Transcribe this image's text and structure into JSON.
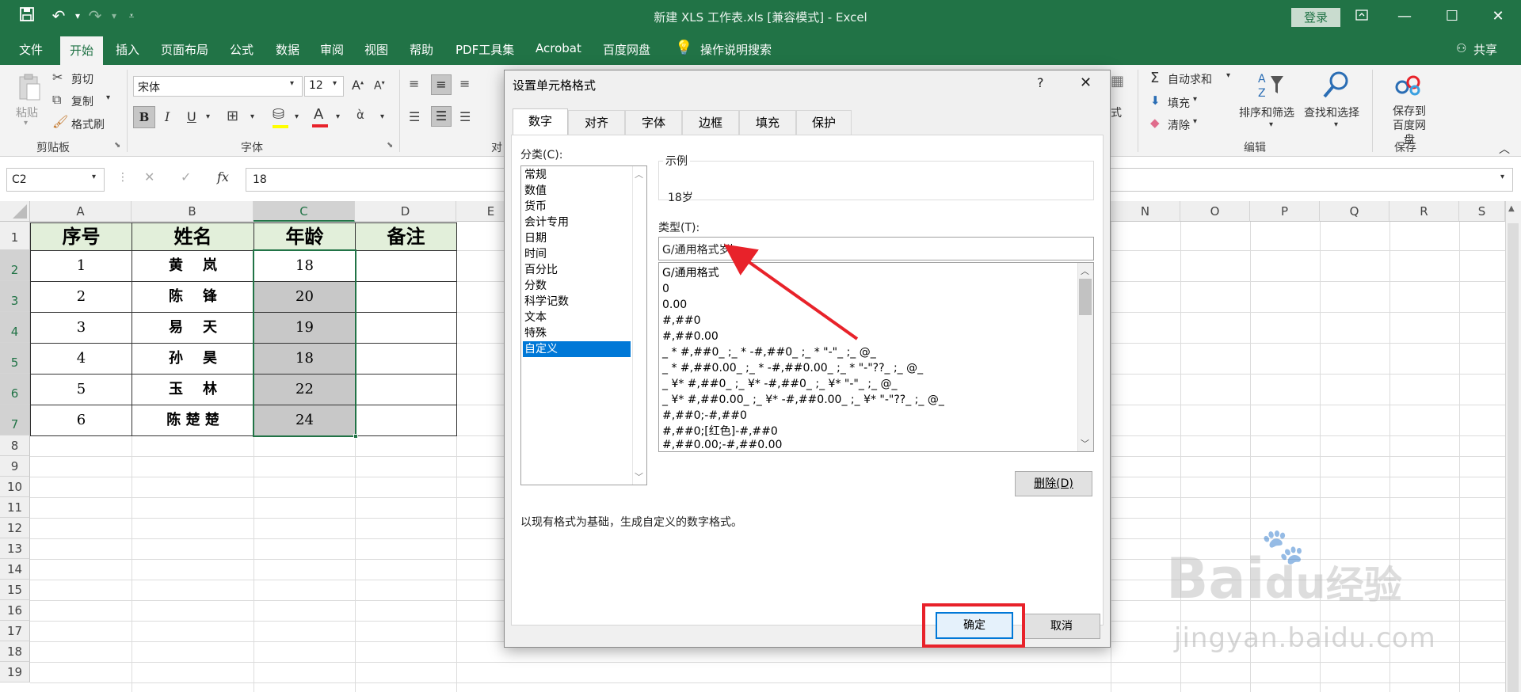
{
  "window": {
    "title": "新建 XLS 工作表.xls  [兼容模式]  -  Excel",
    "login_label": "登录",
    "share_label": "共享"
  },
  "menu": {
    "items": [
      "文件",
      "开始",
      "插入",
      "页面布局",
      "公式",
      "数据",
      "审阅",
      "视图",
      "帮助",
      "PDF工具集",
      "Acrobat",
      "百度网盘"
    ],
    "active": "开始",
    "tell_me": "操作说明搜索"
  },
  "ribbon": {
    "clipboard": {
      "paste": "粘贴",
      "cut": "剪切",
      "copy": "复制",
      "format_painter": "格式刷",
      "label": "剪贴板"
    },
    "font": {
      "name": "宋体",
      "size": "12",
      "label": "字体",
      "bold": "B",
      "italic": "I",
      "underline": "U"
    },
    "align_label_partial": "对",
    "editing": {
      "autosum": "自动求和",
      "fill": "填充",
      "clear": "清除",
      "sort_filter": "排序和筛选",
      "find_select": "查找和选择",
      "label": "编辑"
    },
    "save": {
      "save_baidu": "保存到百度网盘",
      "label": "保存"
    },
    "partial_cells": "式"
  },
  "formula_bar": {
    "name_box": "C2",
    "fx": "fx",
    "value": "18"
  },
  "sheet": {
    "columns": [
      "A",
      "B",
      "C",
      "D",
      "E",
      "N",
      "O",
      "P",
      "Q",
      "R",
      "S"
    ],
    "rows": [
      "1",
      "2",
      "3",
      "4",
      "5",
      "6",
      "7",
      "8",
      "9",
      "10",
      "11",
      "12",
      "13",
      "14",
      "15",
      "16",
      "17",
      "18",
      "19"
    ],
    "headers": [
      "序号",
      "姓名",
      "年龄",
      "备注"
    ],
    "data": [
      {
        "no": "1",
        "name": "黄    岚",
        "age": "18"
      },
      {
        "no": "2",
        "name": "陈    锋",
        "age": "20"
      },
      {
        "no": "3",
        "name": "易    天",
        "age": "19"
      },
      {
        "no": "4",
        "name": "孙    昊",
        "age": "18"
      },
      {
        "no": "5",
        "name": "玉    林",
        "age": "22"
      },
      {
        "no": "6",
        "name": "陈 楚 楚",
        "age": "24"
      }
    ]
  },
  "dialog": {
    "title": "设置单元格格式",
    "help": "?",
    "close": "✕",
    "tabs": [
      "数字",
      "对齐",
      "字体",
      "边框",
      "填充",
      "保护"
    ],
    "active_tab": "数字",
    "category_label": "分类(C):",
    "categories": [
      "常规",
      "数值",
      "货币",
      "会计专用",
      "日期",
      "时间",
      "百分比",
      "分数",
      "科学记数",
      "文本",
      "特殊",
      "自定义"
    ],
    "selected_category": "自定义",
    "sample_label": "示例",
    "sample_value": "18岁",
    "type_label": "类型(T):",
    "type_value": "G/通用格式岁",
    "formats": [
      "G/通用格式",
      "0",
      "0.00",
      "#,##0",
      "#,##0.00",
      "_ * #,##0_ ;_ * -#,##0_ ;_ * \"-\"_ ;_ @_",
      "_ * #,##0.00_ ;_ * -#,##0.00_ ;_ * \"-\"??_ ;_ @_",
      "_ ¥* #,##0_ ;_ ¥* -#,##0_ ;_ ¥* \"-\"_ ;_ @_",
      "_ ¥* #,##0.00_ ;_ ¥* -#,##0.00_ ;_ ¥* \"-\"??_ ;_ @_",
      "#,##0;-#,##0",
      "#,##0;[红色]-#,##0",
      "#,##0.00;-#,##0.00"
    ],
    "delete_label": "删除(D)",
    "description": "以现有格式为基础，生成自定义的数字格式。",
    "ok_label": "确定",
    "cancel_label": "取消"
  },
  "watermark": {
    "brand": "Bai",
    "brand2": "du",
    "brand3": "经验",
    "url": "jingyan.baidu.com"
  },
  "colors": {
    "excel_green": "#217346",
    "selection_blue": "#0078d7",
    "annotation_red": "#e8222a"
  }
}
